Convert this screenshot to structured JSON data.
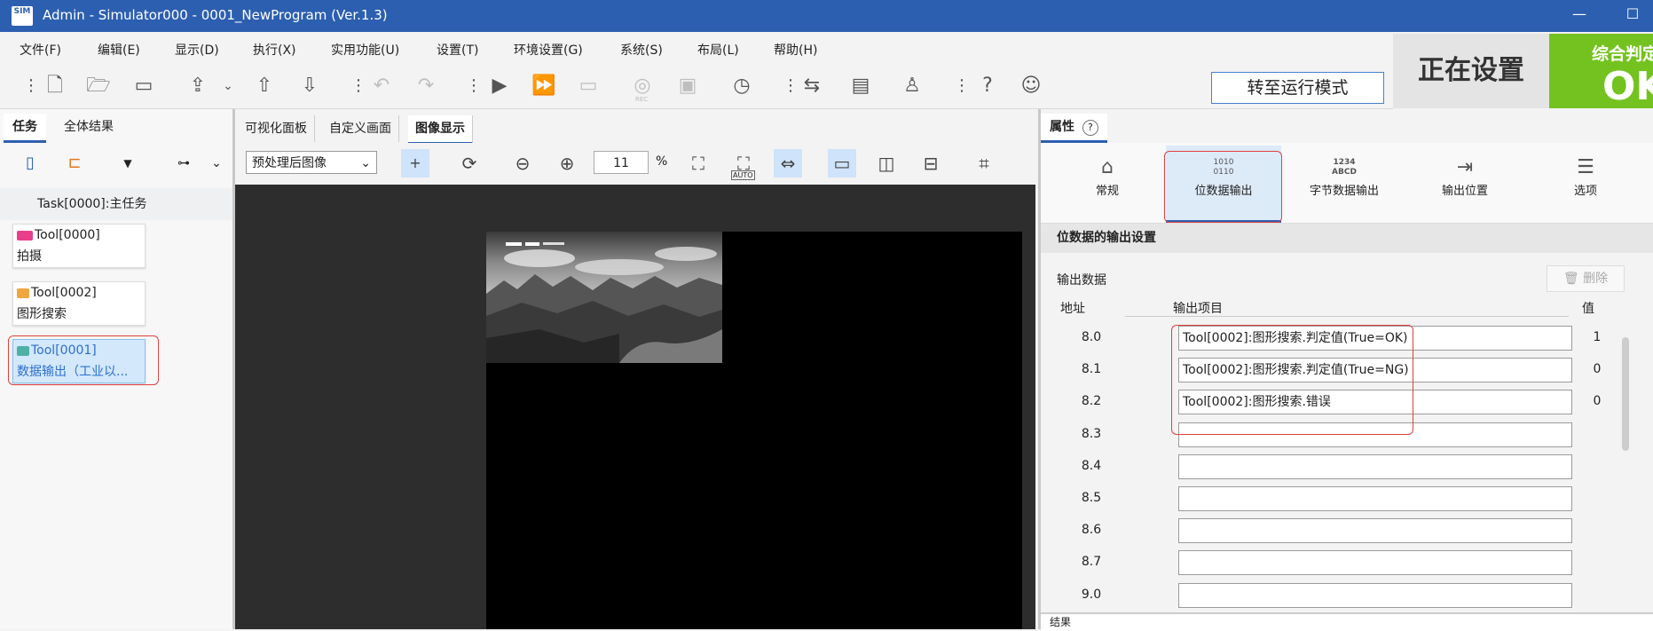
{
  "window": {
    "title": "Admin - Simulator000 - 0001_NewProgram (Ver.1.3)",
    "logo": "SIM"
  },
  "menu": [
    "文件(F)",
    "编辑(E)",
    "显示(D)",
    "执行(X)",
    "实用功能(U)",
    "设置(T)",
    "环境设置(G)",
    "系统(S)",
    "布局(L)",
    "帮助(H)"
  ],
  "toolbar": {
    "run_mode_label": "转至运行模式",
    "rec_label": "REC"
  },
  "status": {
    "setting_label": "正在设置",
    "judge_label": "综合判定",
    "judge_value": "OK"
  },
  "left": {
    "tabs": [
      "任务",
      "全体结果"
    ],
    "task_label": "Task[0000]:主任务",
    "tools": [
      {
        "line1": "Tool[0000]",
        "line2": "拍摄"
      },
      {
        "line1": "Tool[0002]",
        "line2": "图形搜索"
      },
      {
        "line1": "Tool[0001]",
        "line2": "数据输出（工业以..."
      }
    ]
  },
  "center": {
    "tabs": [
      "可视化面板",
      "自定义画面",
      "图像显示"
    ],
    "image_select": "预处理后图像",
    "zoom_value": "11",
    "zoom_unit": "%",
    "auto_label": "AUTO"
  },
  "right": {
    "header": "属性",
    "tabs": [
      {
        "icon": "home-icon",
        "label": "常规"
      },
      {
        "icon": "bits-icon",
        "label": "位数据输出",
        "glyph": "1010\n0110"
      },
      {
        "icon": "bytes-icon",
        "label": "字节数据输出",
        "glyph": "1234\nABCD"
      },
      {
        "icon": "output-position-icon",
        "label": "输出位置"
      },
      {
        "icon": "options-icon",
        "label": "选项"
      }
    ],
    "section_title": "位数据的输出设置",
    "output_data_label": "输出数据",
    "delete_label": "删除",
    "columns": {
      "address": "地址",
      "item": "输出项目",
      "value": "值"
    },
    "rows": [
      {
        "address": "8.0",
        "item": "Tool[0002]:图形搜索.判定值(True=OK)",
        "value": "1"
      },
      {
        "address": "8.1",
        "item": "Tool[0002]:图形搜索.判定值(True=NG)",
        "value": "0"
      },
      {
        "address": "8.2",
        "item": "Tool[0002]:图形搜索.错误",
        "value": "0"
      },
      {
        "address": "8.3",
        "item": "",
        "value": ""
      },
      {
        "address": "8.4",
        "item": "",
        "value": ""
      },
      {
        "address": "8.5",
        "item": "",
        "value": ""
      },
      {
        "address": "8.6",
        "item": "",
        "value": ""
      },
      {
        "address": "8.7",
        "item": "",
        "value": ""
      },
      {
        "address": "9.0",
        "item": "",
        "value": ""
      }
    ],
    "bottom_label": "结果"
  },
  "colors": {
    "titlebar": "#2d5fb0",
    "ok": "#74c21f",
    "highlight": "#e04040"
  }
}
